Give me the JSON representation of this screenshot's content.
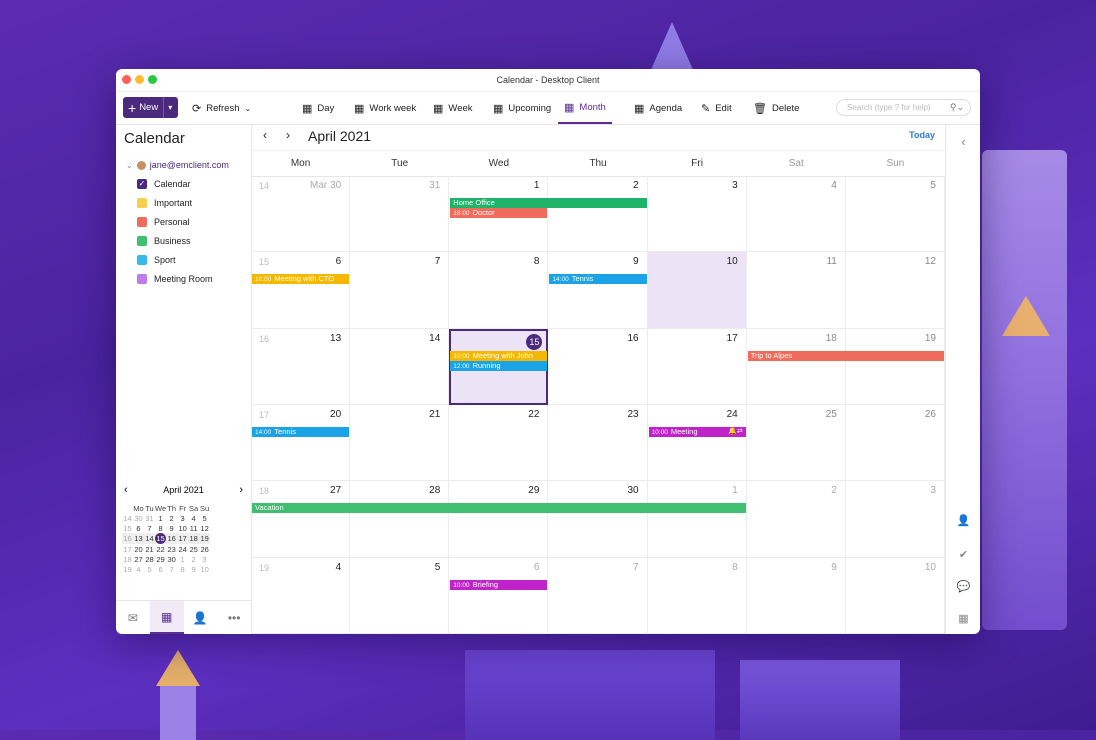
{
  "window": {
    "title": "Calendar - Desktop Client"
  },
  "toolbar": {
    "new_label": "New",
    "refresh_label": "Refresh",
    "views": [
      {
        "label": "Day",
        "icon": "calendar-day-icon"
      },
      {
        "label": "Work week",
        "icon": "calendar-workweek-icon"
      },
      {
        "label": "Week",
        "icon": "calendar-week-icon"
      },
      {
        "label": "Upcoming",
        "icon": "calendar-upcoming-icon"
      },
      {
        "label": "Month",
        "icon": "calendar-month-icon",
        "active": true
      },
      {
        "label": "Agenda",
        "icon": "agenda-icon"
      }
    ],
    "edit_label": "Edit",
    "delete_label": "Delete",
    "search_placeholder": "Search (type ? for help)"
  },
  "sidebar": {
    "title": "Calendar",
    "account": "jane@emclient.com",
    "calendars": [
      {
        "label": "Calendar",
        "color": "#4b2a7e",
        "checked": true
      },
      {
        "label": "Important",
        "color": "#f6d04d"
      },
      {
        "label": "Personal",
        "color": "#ef6b5b"
      },
      {
        "label": "Business",
        "color": "#3fbf6f"
      },
      {
        "label": "Sport",
        "color": "#35b8ea"
      },
      {
        "label": "Meeting Room",
        "color": "#c07be8"
      }
    ]
  },
  "mini_calendar": {
    "title": "April 2021",
    "dow": [
      "Mo",
      "Tu",
      "We",
      "Th",
      "Fr",
      "Sa",
      "Su"
    ],
    "weeks": [
      {
        "wk": "14",
        "days": [
          "30",
          "31",
          "1",
          "2",
          "3",
          "4",
          "5"
        ]
      },
      {
        "wk": "15",
        "days": [
          "6",
          "7",
          "8",
          "9",
          "10",
          "11",
          "12"
        ]
      },
      {
        "wk": "16",
        "days": [
          "13",
          "14",
          "15",
          "16",
          "17",
          "18",
          "19"
        ]
      },
      {
        "wk": "17",
        "days": [
          "20",
          "21",
          "22",
          "23",
          "24",
          "25",
          "26"
        ]
      },
      {
        "wk": "18",
        "days": [
          "27",
          "28",
          "29",
          "30",
          "1",
          "2",
          "3"
        ]
      },
      {
        "wk": "19",
        "days": [
          "4",
          "5",
          "6",
          "7",
          "8",
          "9",
          "10"
        ]
      }
    ],
    "today": "15"
  },
  "bottom_nav": [
    "mail-icon",
    "calendar-icon",
    "contacts-icon",
    "more-icon"
  ],
  "month_view": {
    "title": "April 2021",
    "today_label": "Today",
    "dow": [
      "Mon",
      "Tue",
      "Wed",
      "Thu",
      "Fri",
      "Sat",
      "Sun"
    ],
    "weeks": [
      {
        "wk": "14",
        "days": [
          "Mar 30",
          "31",
          "1",
          "2",
          "3",
          "4",
          "5"
        ]
      },
      {
        "wk": "15",
        "days": [
          "6",
          "7",
          "8",
          "9",
          "10",
          "11",
          "12"
        ]
      },
      {
        "wk": "16",
        "days": [
          "13",
          "14",
          "15",
          "16",
          "17",
          "18",
          "19"
        ]
      },
      {
        "wk": "17",
        "days": [
          "20",
          "21",
          "22",
          "23",
          "24",
          "25",
          "26"
        ]
      },
      {
        "wk": "18",
        "days": [
          "27",
          "28",
          "29",
          "30",
          "1",
          "2",
          "3"
        ]
      },
      {
        "wk": "19",
        "days": [
          "4",
          "5",
          "6",
          "7",
          "8",
          "9",
          "10"
        ]
      }
    ],
    "events": [
      {
        "week": 0,
        "day": 2,
        "span": 2,
        "row": 0,
        "time": "",
        "title": "Home Office",
        "color": "#1fb36a"
      },
      {
        "week": 0,
        "day": 2,
        "span": 1,
        "row": 1,
        "time": "16:00",
        "title": "Doctor",
        "color": "#ef6b5b"
      },
      {
        "week": 1,
        "day": 0,
        "span": 1,
        "row": 0,
        "time": "10:00",
        "title": "Meeting with CTO",
        "color": "#f5b800"
      },
      {
        "week": 1,
        "day": 3,
        "span": 1,
        "row": 0,
        "time": "14:00",
        "title": "Tennis",
        "color": "#1aa3e6"
      },
      {
        "week": 2,
        "day": 2,
        "span": 1,
        "row": 0,
        "time": "10:00",
        "title": "Meeting with John",
        "color": "#f5b800"
      },
      {
        "week": 2,
        "day": 2,
        "span": 1,
        "row": 1,
        "time": "12:00",
        "title": "Running",
        "color": "#1aa3e6"
      },
      {
        "week": 2,
        "day": 5,
        "span": 2,
        "row": 0,
        "time": "",
        "title": "Trip to Alpes",
        "color": "#ef6b5b"
      },
      {
        "week": 3,
        "day": 0,
        "span": 1,
        "row": 0,
        "time": "14:00",
        "title": "Tennis",
        "color": "#1aa3e6"
      },
      {
        "week": 3,
        "day": 4,
        "span": 1,
        "row": 0,
        "time": "10:00",
        "title": "Meeting",
        "color": "#c023c9",
        "icons": "🔔⇄"
      },
      {
        "week": 4,
        "day": 0,
        "span": 5,
        "row": 0,
        "time": "",
        "title": "Vacation",
        "color": "#3fbf6f"
      },
      {
        "week": 5,
        "day": 2,
        "span": 1,
        "row": 0,
        "time": "10:00",
        "title": "Briefing",
        "color": "#c023c9"
      }
    ]
  },
  "right_bar": [
    "collapse-icon",
    "contact-icon",
    "tasks-check-icon",
    "chat-icon",
    "calendar-small-icon"
  ]
}
